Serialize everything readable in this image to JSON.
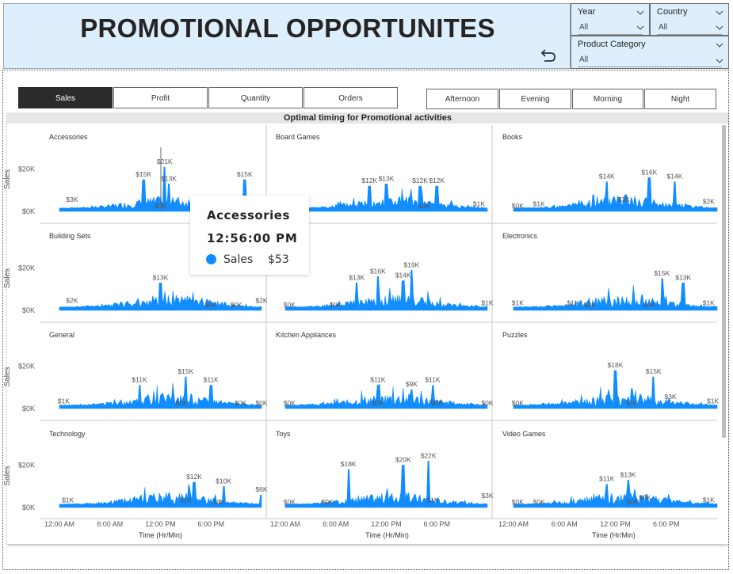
{
  "header": {
    "title": "PROMOTIONAL OPPORTUNITES"
  },
  "slicers": {
    "year": {
      "label": "Year",
      "value": "All"
    },
    "country": {
      "label": "Country",
      "value": "All"
    },
    "product_category": {
      "label": "Product Category",
      "value": "All"
    }
  },
  "metric_buttons": [
    {
      "label": "Sales",
      "active": true
    },
    {
      "label": "Profit",
      "active": false
    },
    {
      "label": "Quantity",
      "active": false
    },
    {
      "label": "Orders",
      "active": false
    }
  ],
  "time_buttons": [
    {
      "label": "Afternoon"
    },
    {
      "label": "Evening"
    },
    {
      "label": "Morning"
    },
    {
      "label": "Night"
    }
  ],
  "colors": {
    "series": "#118dff",
    "active_button": "#2b2b2b",
    "header_bg": "#ddeefc"
  },
  "icons": {
    "undo": "undo-arrow-icon",
    "dropdown": "chevron-down-icon"
  },
  "tooltip": {
    "category": "Accessories",
    "time": "12:56:00 PM",
    "measure": "Sales",
    "value": "$53"
  },
  "chart_data": {
    "type": "area",
    "title": "Optimal timing for Promotional activities",
    "xlabel": "Time (Hr/Min)",
    "ylabel": "Sales",
    "x_ticks": [
      "12:00 AM",
      "6:00 AM",
      "12:00 PM",
      "6:00 PM"
    ],
    "y_ticks": [
      "$0K",
      "$20K"
    ],
    "ylim": [
      0,
      30000
    ],
    "series_color": "#118dff",
    "panels": [
      {
        "name": "Accessories",
        "labels": [
          [
            "$3K",
            1.5,
            3000
          ],
          [
            "$15K",
            10,
            15000
          ],
          [
            "$21K",
            12.5,
            21000
          ],
          [
            "$13K",
            13,
            13000
          ],
          [
            "$0K",
            12,
            0
          ],
          [
            "$15K",
            22,
            15000
          ]
        ]
      },
      {
        "name": "Board Games",
        "labels": [
          [
            "$12K",
            10,
            12000
          ],
          [
            "$13K",
            12,
            13000
          ],
          [
            "$12K",
            16,
            12000
          ],
          [
            "$12K",
            18,
            12000
          ],
          [
            "$0K",
            16.5,
            0
          ],
          [
            "$1K",
            23,
            1000
          ]
        ]
      },
      {
        "name": "Books",
        "labels": [
          [
            "$0K",
            0.5,
            0
          ],
          [
            "$1K",
            3,
            1000
          ],
          [
            "$14K",
            11,
            14000
          ],
          [
            "$16K",
            16,
            16000
          ],
          [
            "$14K",
            19,
            14000
          ],
          [
            "$3K",
            13,
            3000
          ],
          [
            "$2K",
            23,
            2000
          ]
        ]
      },
      {
        "name": "Building Sets",
        "labels": [
          [
            "$2K",
            1.5,
            2000
          ],
          [
            "$13K",
            12,
            13000
          ],
          [
            "$0K",
            18,
            0
          ],
          [
            "$0K",
            21,
            0
          ],
          [
            "$2K",
            24,
            2000
          ]
        ]
      },
      {
        "name": "Cameras",
        "labels": [
          [
            "$0K",
            0.5,
            0
          ],
          [
            "$0K",
            6,
            0
          ],
          [
            "$13K",
            8.5,
            13000
          ],
          [
            "$16K",
            11,
            16000
          ],
          [
            "$14K",
            14,
            14000
          ],
          [
            "$19K",
            15,
            19000
          ],
          [
            "$1K",
            24,
            1000
          ]
        ]
      },
      {
        "name": "Electronics",
        "labels": [
          [
            "$1K",
            0.5,
            1000
          ],
          [
            "$1K",
            7,
            1000
          ],
          [
            "$0K",
            9,
            0
          ],
          [
            "$15K",
            17.5,
            15000
          ],
          [
            "$13K",
            20,
            13000
          ],
          [
            "$0K",
            16,
            0
          ],
          [
            "$1K",
            23,
            1000
          ]
        ]
      },
      {
        "name": "General",
        "labels": [
          [
            "$1K",
            0.5,
            1000
          ],
          [
            "$11K",
            9.5,
            11000
          ],
          [
            "$15K",
            15,
            15000
          ],
          [
            "$11K",
            18,
            11000
          ],
          [
            "$0K",
            14.5,
            0
          ],
          [
            "$0K",
            21.5,
            0
          ],
          [
            "$0K",
            24,
            0
          ]
        ]
      },
      {
        "name": "Kitchen Appliances",
        "labels": [
          [
            "$0K",
            0.5,
            0
          ],
          [
            "$11K",
            11,
            11000
          ],
          [
            "$9K",
            15,
            9000
          ],
          [
            "$11K",
            17.5,
            11000
          ],
          [
            "$0K",
            11,
            0
          ],
          [
            "$0K",
            18,
            0
          ],
          [
            "$0K",
            24,
            0
          ]
        ]
      },
      {
        "name": "Puzzles",
        "labels": [
          [
            "$0K",
            0.5,
            0
          ],
          [
            "$18K",
            12,
            18000
          ],
          [
            "$15K",
            16.5,
            15000
          ],
          [
            "$0K",
            14,
            0
          ],
          [
            "$3K",
            18.5,
            3000
          ],
          [
            "$1K",
            23.5,
            1000
          ]
        ]
      },
      {
        "name": "Technology",
        "labels": [
          [
            "$1K",
            1,
            1000
          ],
          [
            "$12K",
            16,
            12000
          ],
          [
            "$10K",
            19.5,
            10000
          ],
          [
            "$1K",
            15,
            1000
          ],
          [
            "$0K",
            19,
            0
          ],
          [
            "$6K",
            24,
            6000
          ]
        ]
      },
      {
        "name": "Toys",
        "labels": [
          [
            "$0K",
            0.5,
            0
          ],
          [
            "$0K",
            5,
            0
          ],
          [
            "$18K",
            7.5,
            18000
          ],
          [
            "$20K",
            14,
            20000
          ],
          [
            "$22K",
            17,
            22000
          ],
          [
            "$1K",
            17.5,
            1000
          ],
          [
            "$3K",
            24,
            3000
          ]
        ]
      },
      {
        "name": "Video Games",
        "labels": [
          [
            "$0K",
            0.5,
            0
          ],
          [
            "$0K",
            3,
            0
          ],
          [
            "$11K",
            11,
            11000
          ],
          [
            "$13K",
            13.5,
            13000
          ],
          [
            "$0K",
            14,
            0
          ],
          [
            "$2K",
            15.5,
            2000
          ],
          [
            "$1K",
            23,
            1000
          ]
        ]
      }
    ]
  }
}
